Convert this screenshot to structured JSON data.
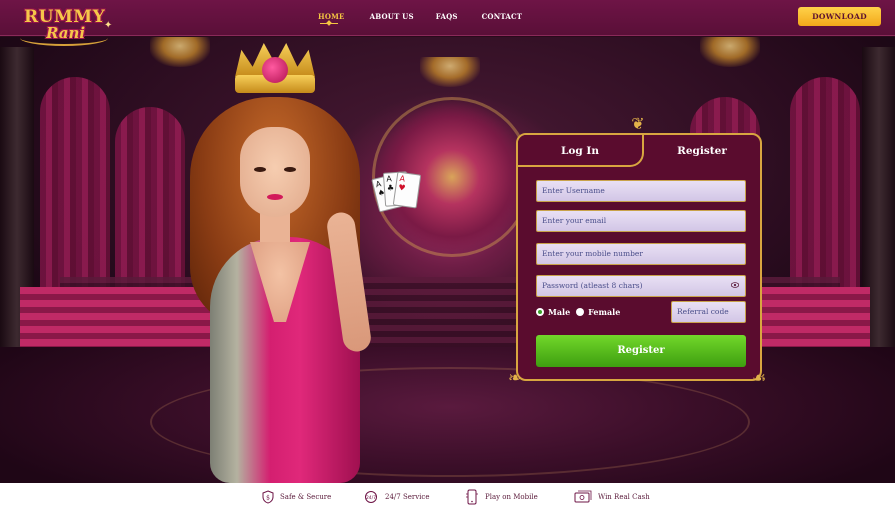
{
  "header": {
    "logo_top": "RUMMY",
    "logo_bottom": "Rani",
    "nav": [
      {
        "label": "HOME",
        "active": true
      },
      {
        "label": "ABOUT US",
        "active": false
      },
      {
        "label": "FAQS",
        "active": false
      },
      {
        "label": "CONTACT",
        "active": false
      }
    ],
    "download_label": "DOWNLOAD"
  },
  "auth_panel": {
    "tabs": [
      {
        "label": "Log In",
        "selected": false
      },
      {
        "label": "Register",
        "selected": true
      }
    ],
    "fields": {
      "username_placeholder": "Enter Username",
      "email_placeholder": "Enter your email",
      "mobile_placeholder": "Enter your mobile number",
      "password_placeholder": "Password (atleast 8 chars)",
      "referral_placeholder": "Referral code"
    },
    "gender": {
      "options": [
        "Male",
        "Female"
      ],
      "selected": "Male"
    },
    "submit_label": "Register"
  },
  "features": [
    {
      "label": "Safe & Secure",
      "icon": "shield-icon"
    },
    {
      "label": "24/7 Service",
      "icon": "support-icon"
    },
    {
      "label": "Play on Mobile",
      "icon": "mobile-icon"
    },
    {
      "label": "Win Real Cash",
      "icon": "cash-icon"
    }
  ],
  "colors": {
    "brand": "#6e1446",
    "accent_gold": "#f4c542",
    "panel_bg": "#5a0c2e",
    "submit_green": "#4caf1a"
  }
}
